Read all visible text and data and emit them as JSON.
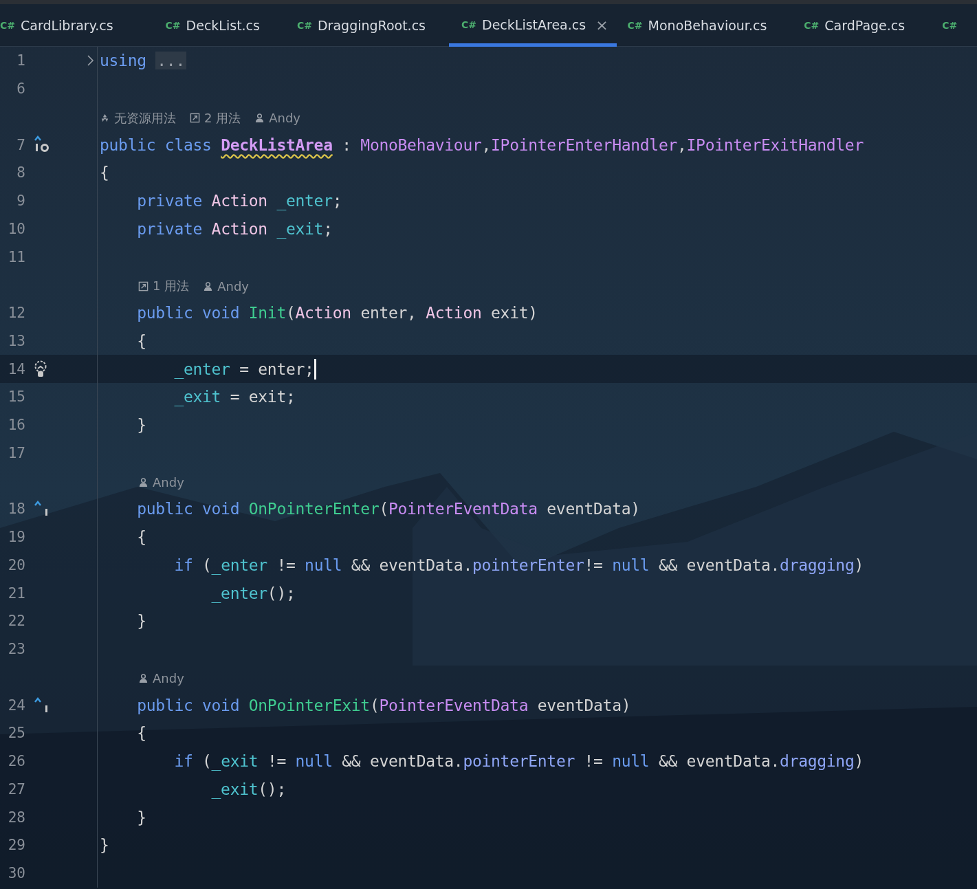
{
  "tabs": [
    {
      "lang": "C#",
      "name": "CardLibrary.cs",
      "selected": false
    },
    {
      "lang": "C#",
      "name": "DeckList.cs",
      "selected": false
    },
    {
      "lang": "C#",
      "name": "DraggingRoot.cs",
      "selected": false
    },
    {
      "lang": "C#",
      "name": "DeckListArea.cs",
      "selected": true,
      "close": "×"
    },
    {
      "lang": "C#",
      "name": "MonoBehaviour.cs",
      "selected": false
    },
    {
      "lang": "C#",
      "name": "CardPage.cs",
      "selected": false
    },
    {
      "lang": "C#",
      "selected": false
    }
  ],
  "rows": [
    {
      "kind": "code",
      "number": "1",
      "marker": {
        "kind": "fold"
      },
      "tokens": [
        {
          "kind": "keyword",
          "text": "using "
        },
        {
          "kind": "folded",
          "text": "..."
        }
      ]
    },
    {
      "kind": "code",
      "number": "6",
      "tokens": []
    },
    {
      "kind": "class-hint",
      "items": [
        {
          "kind": "unity",
          "text": "无资源用法"
        },
        {
          "kind": "usages",
          "text": "2 用法"
        },
        {
          "kind": "author",
          "text": "Andy"
        }
      ]
    },
    {
      "kind": "code",
      "number": "7",
      "marker": {
        "kind": "implements"
      },
      "tokens": [
        {
          "kind": "keyword",
          "text": "public class "
        },
        {
          "kind": "declaration",
          "text": "DeckListArea"
        },
        {
          "kind": "plain",
          "text": " : "
        },
        {
          "kind": "class",
          "text": "MonoBehaviour"
        },
        {
          "kind": "plain",
          "text": ","
        },
        {
          "kind": "class",
          "text": "IPointerEnterHandler"
        },
        {
          "kind": "plain",
          "text": ","
        },
        {
          "kind": "class",
          "text": "IPointerExitHandler"
        }
      ]
    },
    {
      "kind": "code",
      "number": "8",
      "tokens": [
        {
          "kind": "plain",
          "text": "{"
        }
      ]
    },
    {
      "kind": "code",
      "number": "9",
      "tokens": [
        {
          "kind": "keyword",
          "text": "    private "
        },
        {
          "kind": "delegate",
          "text": "Action"
        },
        {
          "kind": "field",
          "text": " _enter"
        },
        {
          "kind": "plain",
          "text": ";"
        }
      ]
    },
    {
      "kind": "code",
      "number": "10",
      "tokens": [
        {
          "kind": "keyword",
          "text": "    private "
        },
        {
          "kind": "delegate",
          "text": "Action"
        },
        {
          "kind": "field",
          "text": " _exit"
        },
        {
          "kind": "plain",
          "text": ";"
        }
      ]
    },
    {
      "kind": "code",
      "number": "11",
      "tokens": []
    },
    {
      "kind": "member-hint",
      "items": [
        {
          "kind": "usages",
          "text": "1 用法"
        },
        {
          "kind": "author",
          "text": "Andy"
        }
      ]
    },
    {
      "kind": "code",
      "number": "12",
      "tokens": [
        {
          "kind": "keyword",
          "text": "    public void "
        },
        {
          "kind": "method",
          "text": "Init"
        },
        {
          "kind": "plain",
          "text": "("
        },
        {
          "kind": "delegate",
          "text": "Action"
        },
        {
          "kind": "plain",
          "text": " enter, "
        },
        {
          "kind": "delegate",
          "text": "Action"
        },
        {
          "kind": "plain",
          "text": " exit)"
        }
      ]
    },
    {
      "kind": "code",
      "number": "13",
      "tokens": [
        {
          "kind": "plain",
          "text": "    {"
        }
      ]
    },
    {
      "kind": "code",
      "number": "14",
      "marker": {
        "kind": "bulb"
      },
      "current": true,
      "caret": true,
      "tokens": [
        {
          "kind": "field",
          "text": "        _enter"
        },
        {
          "kind": "plain",
          "text": " = enter;"
        }
      ]
    },
    {
      "kind": "code",
      "number": "15",
      "tokens": [
        {
          "kind": "field",
          "text": "        _exit"
        },
        {
          "kind": "plain",
          "text": " = exit;"
        }
      ]
    },
    {
      "kind": "code",
      "number": "16",
      "tokens": [
        {
          "kind": "plain",
          "text": "    }"
        }
      ]
    },
    {
      "kind": "code",
      "number": "17",
      "tokens": []
    },
    {
      "kind": "member-hint",
      "items": [
        {
          "kind": "author",
          "text": "Andy"
        }
      ]
    },
    {
      "kind": "code",
      "number": "18",
      "marker": {
        "kind": "override"
      },
      "tokens": [
        {
          "kind": "keyword",
          "text": "    public void "
        },
        {
          "kind": "method",
          "text": "OnPointerEnter"
        },
        {
          "kind": "plain",
          "text": "("
        },
        {
          "kind": "class",
          "text": "PointerEventData"
        },
        {
          "kind": "plain",
          "text": " eventData)"
        }
      ]
    },
    {
      "kind": "code",
      "number": "19",
      "tokens": [
        {
          "kind": "plain",
          "text": "    {"
        }
      ]
    },
    {
      "kind": "code",
      "number": "20",
      "tokens": [
        {
          "kind": "keyword",
          "text": "        if "
        },
        {
          "kind": "plain",
          "text": "("
        },
        {
          "kind": "field",
          "text": "_enter"
        },
        {
          "kind": "plain",
          "text": " != "
        },
        {
          "kind": "keyword",
          "text": "null"
        },
        {
          "kind": "plain",
          "text": " && eventData."
        },
        {
          "kind": "property",
          "text": "pointerEnter"
        },
        {
          "kind": "plain",
          "text": "!= "
        },
        {
          "kind": "keyword",
          "text": "null"
        },
        {
          "kind": "plain",
          "text": " && eventData."
        },
        {
          "kind": "property",
          "text": "dragging"
        },
        {
          "kind": "plain",
          "text": ")"
        }
      ]
    },
    {
      "kind": "code",
      "number": "21",
      "tokens": [
        {
          "kind": "field",
          "text": "            _enter"
        },
        {
          "kind": "plain",
          "text": "();"
        }
      ]
    },
    {
      "kind": "code",
      "number": "22",
      "tokens": [
        {
          "kind": "plain",
          "text": "    }"
        }
      ]
    },
    {
      "kind": "code",
      "number": "23",
      "tokens": []
    },
    {
      "kind": "member-hint",
      "items": [
        {
          "kind": "author",
          "text": "Andy"
        }
      ]
    },
    {
      "kind": "code",
      "number": "24",
      "marker": {
        "kind": "override"
      },
      "tokens": [
        {
          "kind": "keyword",
          "text": "    public void "
        },
        {
          "kind": "method",
          "text": "OnPointerExit"
        },
        {
          "kind": "plain",
          "text": "("
        },
        {
          "kind": "class",
          "text": "PointerEventData"
        },
        {
          "kind": "plain",
          "text": " eventData)"
        }
      ]
    },
    {
      "kind": "code",
      "number": "25",
      "tokens": [
        {
          "kind": "plain",
          "text": "    {"
        }
      ]
    },
    {
      "kind": "code",
      "number": "26",
      "tokens": [
        {
          "kind": "keyword",
          "text": "        if "
        },
        {
          "kind": "plain",
          "text": "("
        },
        {
          "kind": "field",
          "text": "_exit"
        },
        {
          "kind": "plain",
          "text": " != "
        },
        {
          "kind": "keyword",
          "text": "null"
        },
        {
          "kind": "plain",
          "text": " && eventData."
        },
        {
          "kind": "property",
          "text": "pointerEnter"
        },
        {
          "kind": "plain",
          "text": " != "
        },
        {
          "kind": "keyword",
          "text": "null"
        },
        {
          "kind": "plain",
          "text": " && eventData."
        },
        {
          "kind": "property",
          "text": "dragging"
        },
        {
          "kind": "plain",
          "text": ")"
        }
      ]
    },
    {
      "kind": "code",
      "number": "27",
      "tokens": [
        {
          "kind": "field",
          "text": "            _exit"
        },
        {
          "kind": "plain",
          "text": "();"
        }
      ]
    },
    {
      "kind": "code",
      "number": "28",
      "tokens": [
        {
          "kind": "plain",
          "text": "    }"
        }
      ]
    },
    {
      "kind": "code",
      "number": "29",
      "tokens": [
        {
          "kind": "plain",
          "text": "}"
        }
      ]
    },
    {
      "kind": "code",
      "number": "30",
      "tokens": []
    }
  ]
}
